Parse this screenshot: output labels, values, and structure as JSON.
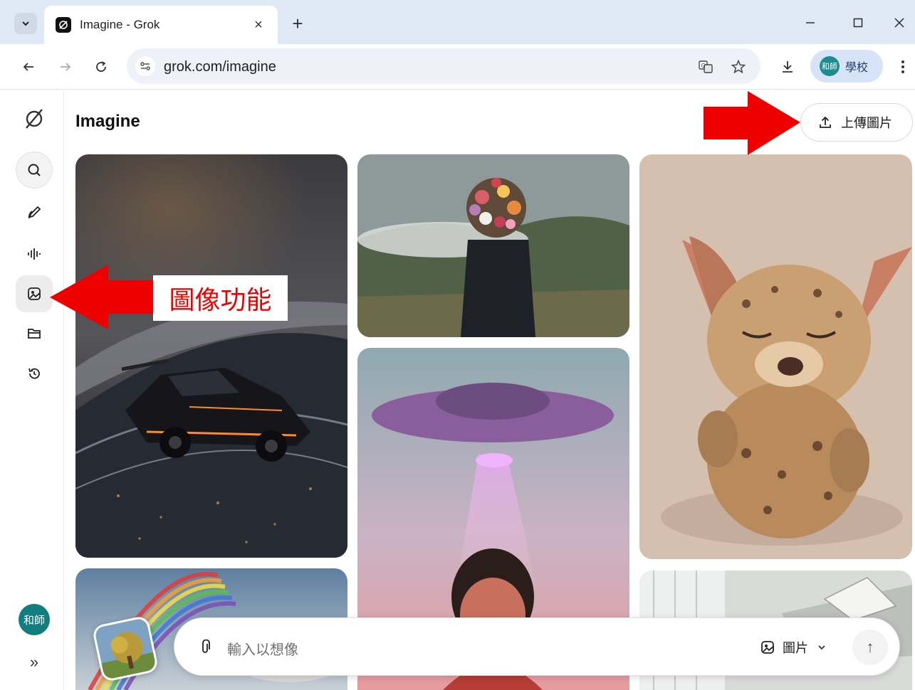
{
  "browser": {
    "tab_title": "Imagine - Grok",
    "new_tab": "+",
    "close_tab": "×",
    "url": "grok.com/imagine",
    "profile_avatar": "和師",
    "profile_name": "學校"
  },
  "sidebar": {
    "items": [
      {
        "name": "search",
        "icon": "search-icon"
      },
      {
        "name": "edit",
        "icon": "edit-icon"
      },
      {
        "name": "voice",
        "icon": "waveform-icon"
      },
      {
        "name": "imagine",
        "icon": "image-icon"
      },
      {
        "name": "projects",
        "icon": "folder-icon"
      },
      {
        "name": "history",
        "icon": "history-icon"
      }
    ],
    "avatar": "和師",
    "expand": "»"
  },
  "page": {
    "title": "Imagine",
    "upload_label": "上傳圖片"
  },
  "annotation": {
    "callout": "圖像功能",
    "arrow_color": "#ee0000"
  },
  "prompt": {
    "placeholder": "輸入以想像",
    "mode_label": "圖片",
    "send": "↑"
  },
  "gallery": [
    {
      "name": "race-car-image"
    },
    {
      "name": "flower-head-man-image"
    },
    {
      "name": "fluffy-creature-image"
    },
    {
      "name": "ufo-boy-image"
    },
    {
      "name": "rainbow-image"
    },
    {
      "name": "interior-image"
    }
  ]
}
